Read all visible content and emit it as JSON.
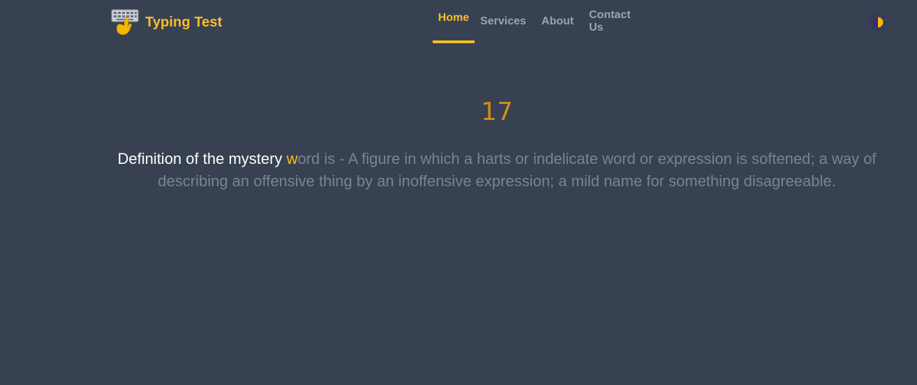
{
  "brand": {
    "title": "Typing Test",
    "icon": "keyboard-hand-icon"
  },
  "nav": {
    "items": [
      {
        "label": "Home",
        "active": true
      },
      {
        "label": "Services",
        "active": false
      },
      {
        "label": "About",
        "active": false
      },
      {
        "label": "Contact Us",
        "active": false
      }
    ]
  },
  "theme_toggle": {
    "icon": "half-sun-icon"
  },
  "test": {
    "timer": "17",
    "typed_text": "Definition of the mystery ",
    "current_char": "w",
    "remaining_text": "ord is - A figure in which a harts or indelicate word or expression is softened; a way of describing an offensive thing by an inoffensive expression; a mild name for something disagreeable."
  },
  "colors": {
    "background": "#374151",
    "accent": "#FBBF24",
    "timer": "#D18C1B",
    "typed": "#FFFFFF",
    "untyped": "#7A8392",
    "nav_inactive": "#9CA3AF"
  }
}
